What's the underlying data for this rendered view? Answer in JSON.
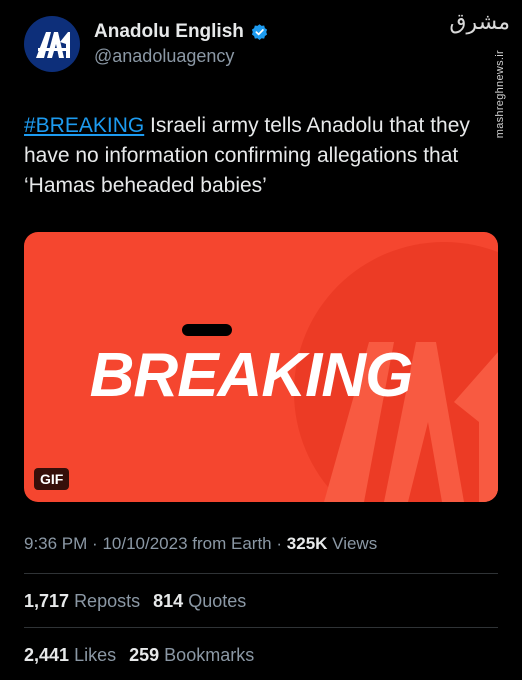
{
  "account": {
    "display_name": "Anadolu English",
    "handle": "@anadoluagency",
    "verified_color": "#1d9bf0",
    "avatar_color": "#0d2f7a"
  },
  "watermark": {
    "url": "mashreghnews.ir",
    "logo_text": "مشرق"
  },
  "tweet": {
    "hashtag": "#BREAKING",
    "text": " Israeli army tells Anadolu that they have no information confirming allegations that ‘Hamas beheaded babies’"
  },
  "media": {
    "headline": "BREAKING",
    "badge": "GIF",
    "background_color": "#f5462f"
  },
  "meta": {
    "time": "9:36 PM",
    "date": "10/10/2023",
    "source": "from Earth",
    "views_count": "325K",
    "views_label": "Views",
    "separator": "·"
  },
  "stats": {
    "reposts_count": "1,717",
    "reposts_label": "Reposts",
    "quotes_count": "814",
    "quotes_label": "Quotes",
    "likes_count": "2,441",
    "likes_label": "Likes",
    "bookmarks_count": "259",
    "bookmarks_label": "Bookmarks"
  }
}
